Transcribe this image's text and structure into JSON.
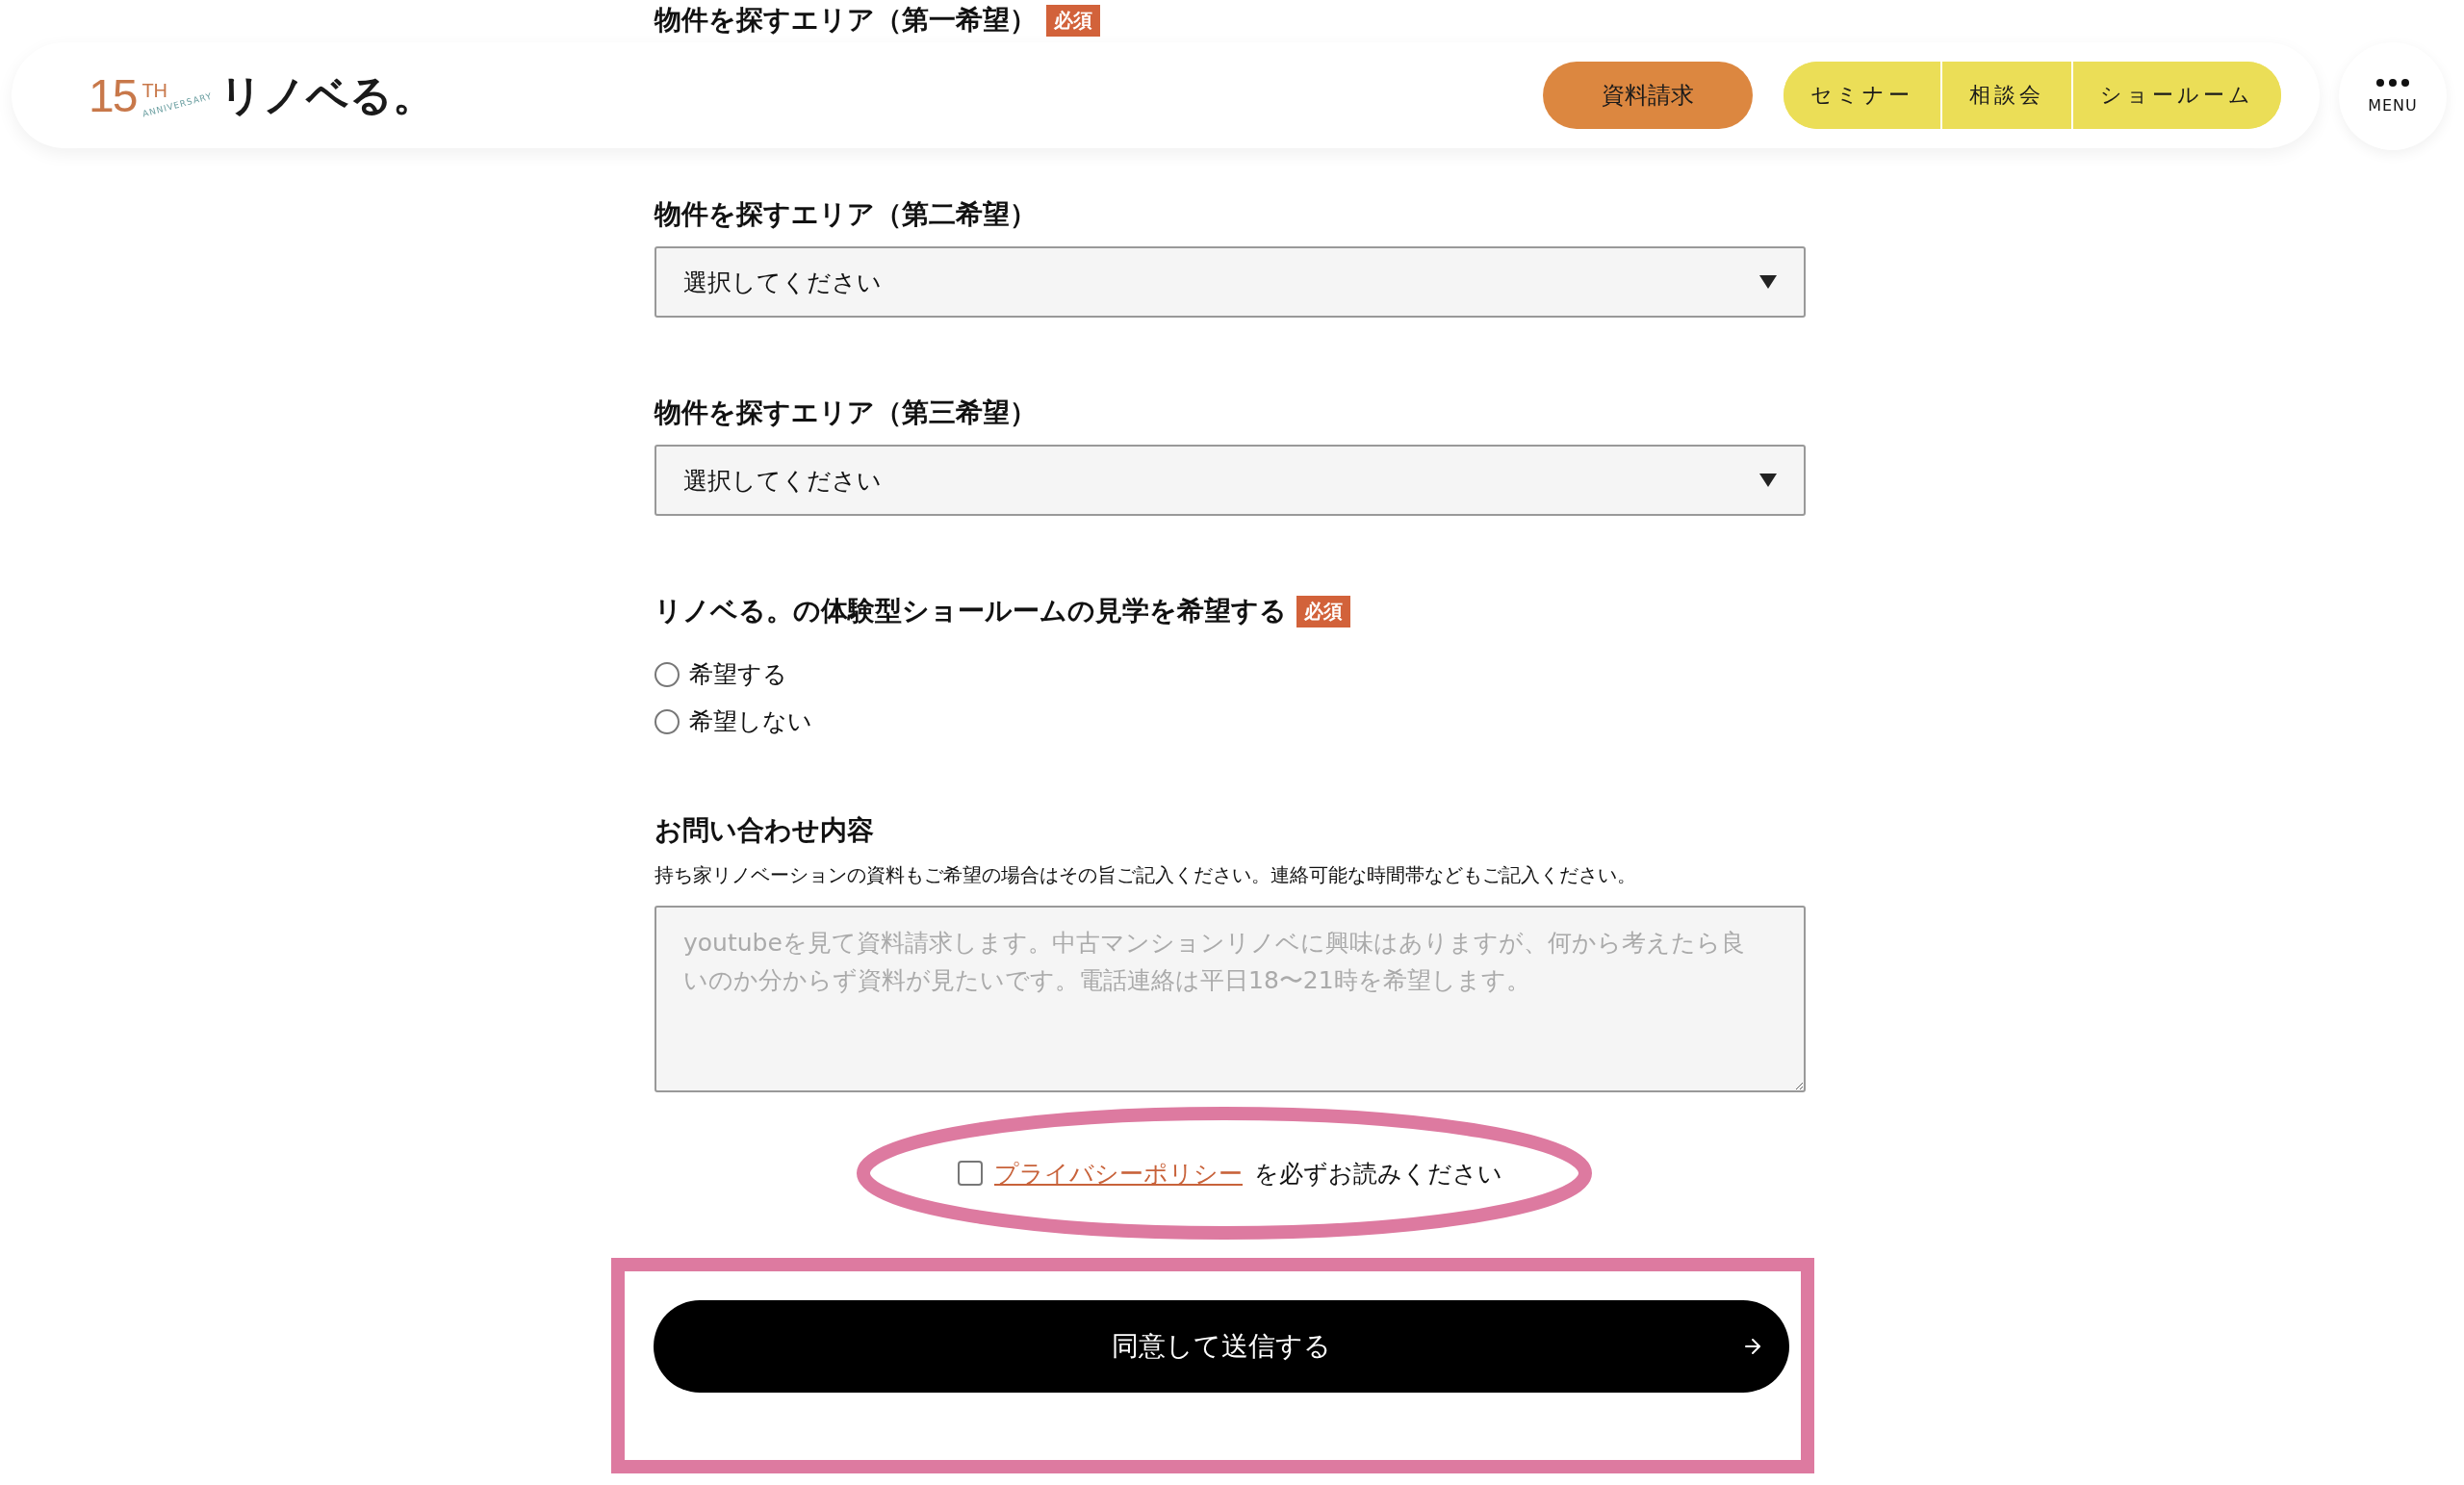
{
  "header": {
    "logo": {
      "number": "15",
      "suffix": "TH",
      "arc": "ANNIVERSARY",
      "name": "リノベる。"
    },
    "request_button": "資料請求",
    "nav": [
      {
        "label": "セミナー"
      },
      {
        "label": "相談会"
      },
      {
        "label": "ショールーム"
      }
    ],
    "menu_label": "MENU"
  },
  "form": {
    "fields": [
      {
        "kind": "heading",
        "label": "物件を探すエリア（第一希望）",
        "required": true,
        "required_label": "必須"
      },
      {
        "kind": "select",
        "label": "物件を探すエリア（第二希望）",
        "required": false,
        "value": "選択してください"
      },
      {
        "kind": "select",
        "label": "物件を探すエリア（第三希望）",
        "required": false,
        "value": "選択してください"
      },
      {
        "kind": "radio",
        "label": "リノベる。の体験型ショールームの見学を希望する",
        "required": true,
        "required_label": "必須",
        "options": [
          {
            "label": "希望する",
            "selected": false
          },
          {
            "label": "希望しない",
            "selected": false
          }
        ]
      },
      {
        "kind": "textarea",
        "label": "お問い合わせ内容",
        "required": false,
        "note": "持ち家リノベーションの資料もご希望の場合はその旨ご記入ください。連絡可能な時間帯などもご記入ください。",
        "placeholder": "youtubeを見て資料請求します。中古マンションリノベに興味はありますが、何から考えたら良いのか分からず資料が見たいです。電話連絡は平日18〜21時を希望します。"
      }
    ],
    "consent": {
      "checked": false,
      "link": "プライバシーポリシー",
      "text": "を必ずお読みください"
    },
    "submit": {
      "label": "同意して送信する"
    }
  }
}
